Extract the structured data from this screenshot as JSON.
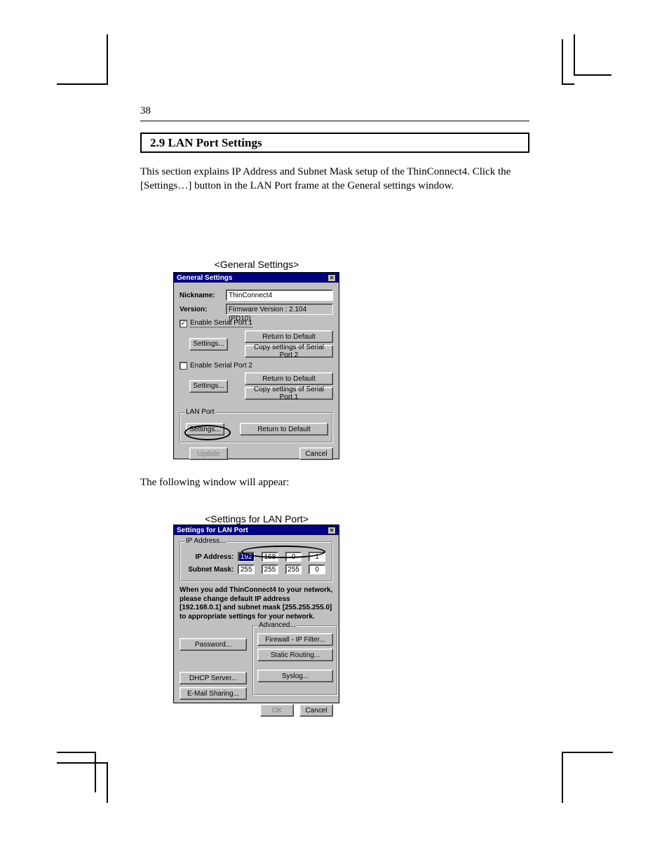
{
  "page": {
    "number": "38",
    "section_title": "2.9 LAN Port Settings",
    "para1": "This section explains IP Address and Subnet Mask setup of the ThinConnect4. Click the [Settings…] button in the LAN Port frame at the General settings window.",
    "caption1": "<General Settings>",
    "para2": "The following window will appear:",
    "caption2": "<Settings for LAN Port>"
  },
  "dlg1": {
    "title": "General Settings",
    "nickname_label": "Nickname:",
    "nickname_value": "ThinConnect4",
    "version_label": "Version:",
    "version_value": "Firmware Version : 2.104  (PD10)",
    "enable_sp1": "Enable Serial Port 1",
    "enable_sp2": "Enable Serial Port 2",
    "settings": "Settings...",
    "return_default": "Return to Default",
    "copy_sp2": "Copy settings of Serial Port 2",
    "copy_sp1": "Copy settings of Serial Port 1",
    "lan_port": "LAN Port",
    "update": "Update",
    "cancel": "Cancel"
  },
  "dlg2": {
    "title": "Settings for LAN Port",
    "ip_group": "IP Address...",
    "ip_label": "IP Address:",
    "ip": [
      "192",
      "168",
      "0",
      "1"
    ],
    "mask_label": "Subnet Mask:",
    "mask": [
      "255",
      "255",
      "255",
      "0"
    ],
    "note": "When you add ThinConnect4 to your network, please change default IP address [192.168.0.1] and subnet mask [255.255.255.0] to appropriate settings for your network.",
    "adv_label": "Advanced...",
    "password": "Password...",
    "dhcp": "DHCP Server...",
    "email": "E-Mail Sharing...",
    "firewall": "Firewall - IP Filter...",
    "static_routing": "Static Routing...",
    "syslog": "Syslog...",
    "ok": "OK",
    "cancel": "Cancel"
  }
}
